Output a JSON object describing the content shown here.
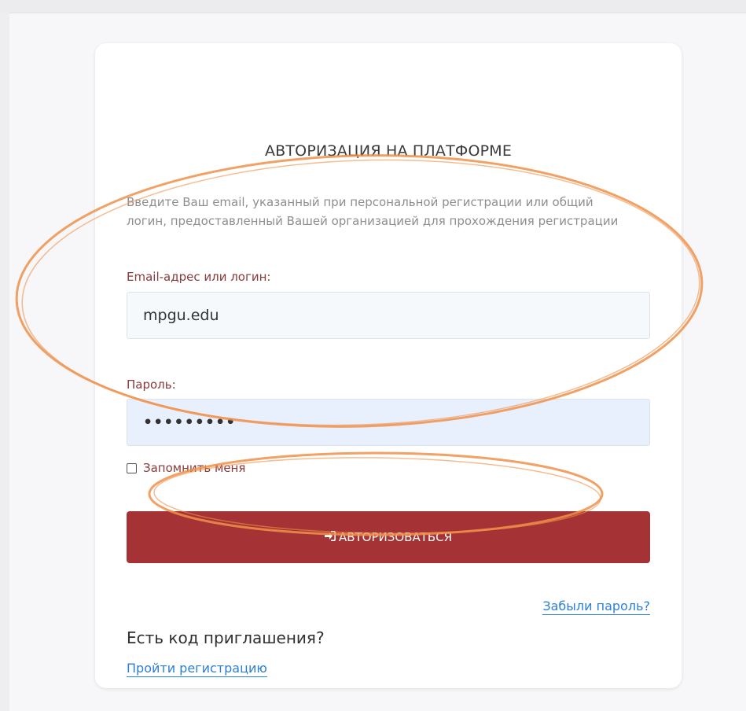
{
  "title": "АВТОРИЗАЦИЯ НА ПЛАТФОРМЕ",
  "intro": "Введите Ваш email, указанный при персональной регистрации или общий логин, предоставленный Вашей организацией для прохождения регистрации",
  "email": {
    "label": "Email-адрес или логин:",
    "value": "mpgu.edu"
  },
  "password": {
    "label": "Пароль:",
    "value": "•••••••••"
  },
  "remember_label": "Запомнить меня",
  "login_button": {
    "label": "АВТОРИЗОВАТЬСЯ",
    "icon": "sign-in-icon"
  },
  "forgot_link": "Забыли пароль?",
  "invite_heading": "Есть код приглашения?",
  "register_link": "Пройти регистрацию",
  "colors": {
    "accent": "#a53234",
    "link": "#2b7fd6",
    "annotation": "#f0904a"
  }
}
